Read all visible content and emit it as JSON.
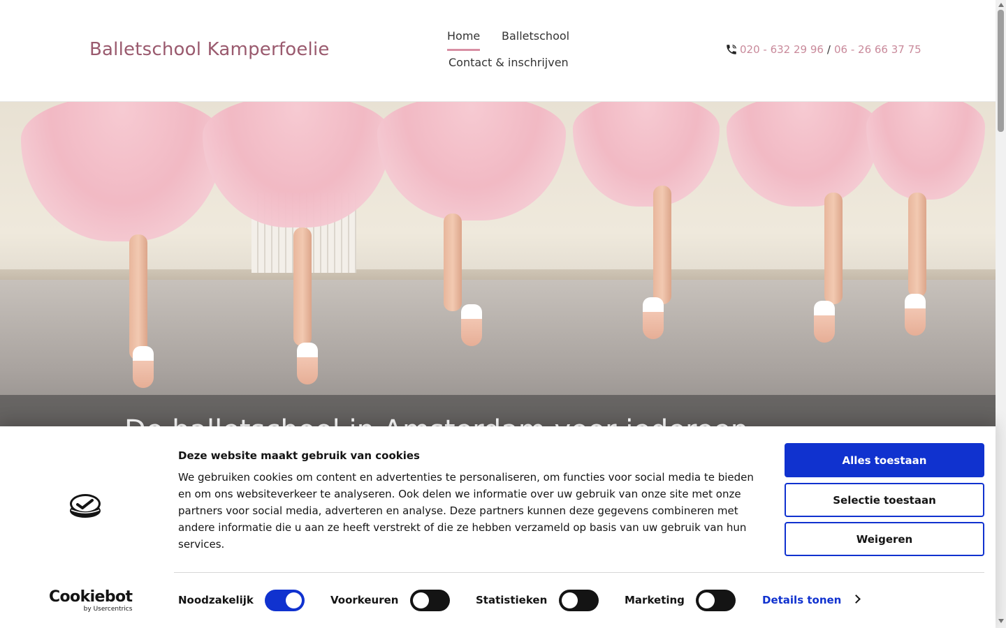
{
  "header": {
    "brand": "Balletschool Kamperfoelie",
    "nav": {
      "home": "Home",
      "balletschool": "Balletschool",
      "contact": "Contact & inschrijven"
    },
    "phone1": "020 - 632 29 96",
    "separator": "/",
    "phone2": "06 - 26 66 37 75",
    "accent_color": "#c98a9b"
  },
  "hero": {
    "title_partial": "De balletschool in Amsterdam voor iedereen"
  },
  "cookie": {
    "title": "Deze website maakt gebruik van cookies",
    "text": "We gebruiken cookies om content en advertenties te personaliseren, om functies voor social media te bieden en om ons websiteverkeer te analyseren. Ook delen we informatie over uw gebruik van onze site met onze partners voor social media, adverteren en analyse. Deze partners kunnen deze gegevens combineren met andere informatie die u aan ze heeft verstrekt of die ze hebben verzameld op basis van uw gebruik van hun services.",
    "buttons": {
      "allow_all": "Alles toestaan",
      "allow_selection": "Selectie toestaan",
      "deny": "Weigeren"
    },
    "brand_main": "Cookiebot",
    "brand_sub": "by Usercentrics",
    "toggles": [
      {
        "label": "Noodzakelijk",
        "on": true
      },
      {
        "label": "Voorkeuren",
        "on": false
      },
      {
        "label": "Statistieken",
        "on": false
      },
      {
        "label": "Marketing",
        "on": false
      }
    ],
    "details": "Details tonen",
    "primary_color": "#1032cf"
  }
}
